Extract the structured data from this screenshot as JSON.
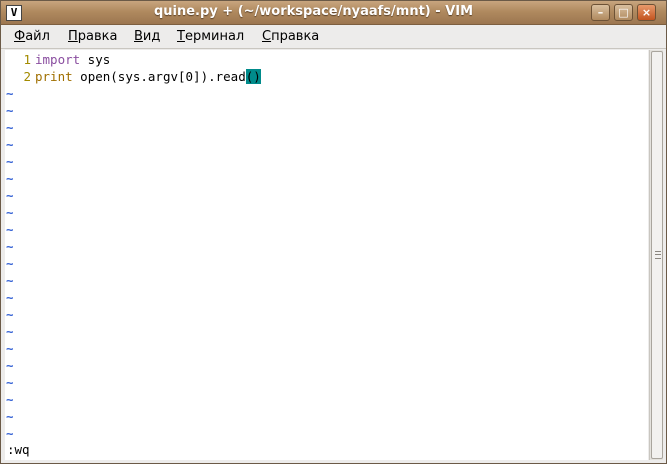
{
  "window": {
    "title": "quine.py + (~/workspace/nyaafs/mnt) - VIM",
    "icon_char": "V",
    "buttons": {
      "minimize": "–",
      "maximize": "□",
      "close": "×"
    }
  },
  "menubar": [
    {
      "first": "Ф",
      "rest": "айл"
    },
    {
      "first": "П",
      "rest": "равка"
    },
    {
      "first": "В",
      "rest": "ид"
    },
    {
      "first": "Т",
      "rest": "ерминал"
    },
    {
      "first": "С",
      "rest": "правка"
    }
  ],
  "editor": {
    "lines": [
      {
        "num": "1",
        "kw": "import",
        "rest": " sys"
      },
      {
        "num": "2",
        "kw": "print",
        "rest": " open(sys.argv[0]).read",
        "match": "()"
      }
    ],
    "tilde": "~",
    "command_line": ":wq"
  },
  "colors": {
    "titlebar": "#b08a5f",
    "line_number": "#a38b00",
    "keyword_import": "#8a4ea0",
    "keyword_print": "#a06f00",
    "tilde": "#3a66d6",
    "paren_match": "#008b8b"
  }
}
